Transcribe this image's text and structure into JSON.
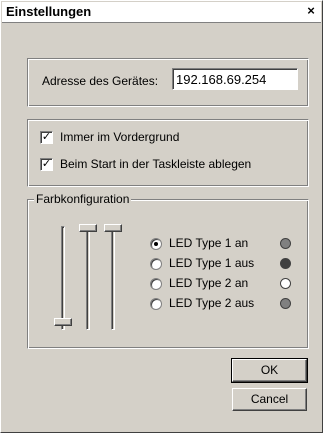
{
  "window": {
    "title": "Einstellungen",
    "close_label": "×"
  },
  "address_group": {
    "label": "Adresse des Gerätes:",
    "value": "192.168.69.254"
  },
  "options_group": {
    "always_on_top": {
      "label": "Immer im Vordergrund",
      "checked": true,
      "mark": "✓"
    },
    "start_in_tray": {
      "label": "Beim Start in der Taskleiste ablegen",
      "checked": true,
      "mark": "✓"
    }
  },
  "color_group": {
    "legend": "Farbkonfiguration",
    "radios": [
      {
        "label": "LED Type 1 an",
        "checked": true,
        "led_color": "#808080"
      },
      {
        "label": "LED Type 1 aus",
        "checked": false,
        "led_color": "#404040"
      },
      {
        "label": "LED Type 2 an",
        "checked": false,
        "led_color": "#ffffff"
      },
      {
        "label": "LED Type 2 aus",
        "checked": false,
        "led_color": "#808080"
      }
    ],
    "sliders": [
      {
        "value": 0.0
      },
      {
        "value": 1.0
      },
      {
        "value": 1.0
      }
    ]
  },
  "buttons": {
    "ok_label": "OK",
    "cancel_label": "Cancel"
  }
}
